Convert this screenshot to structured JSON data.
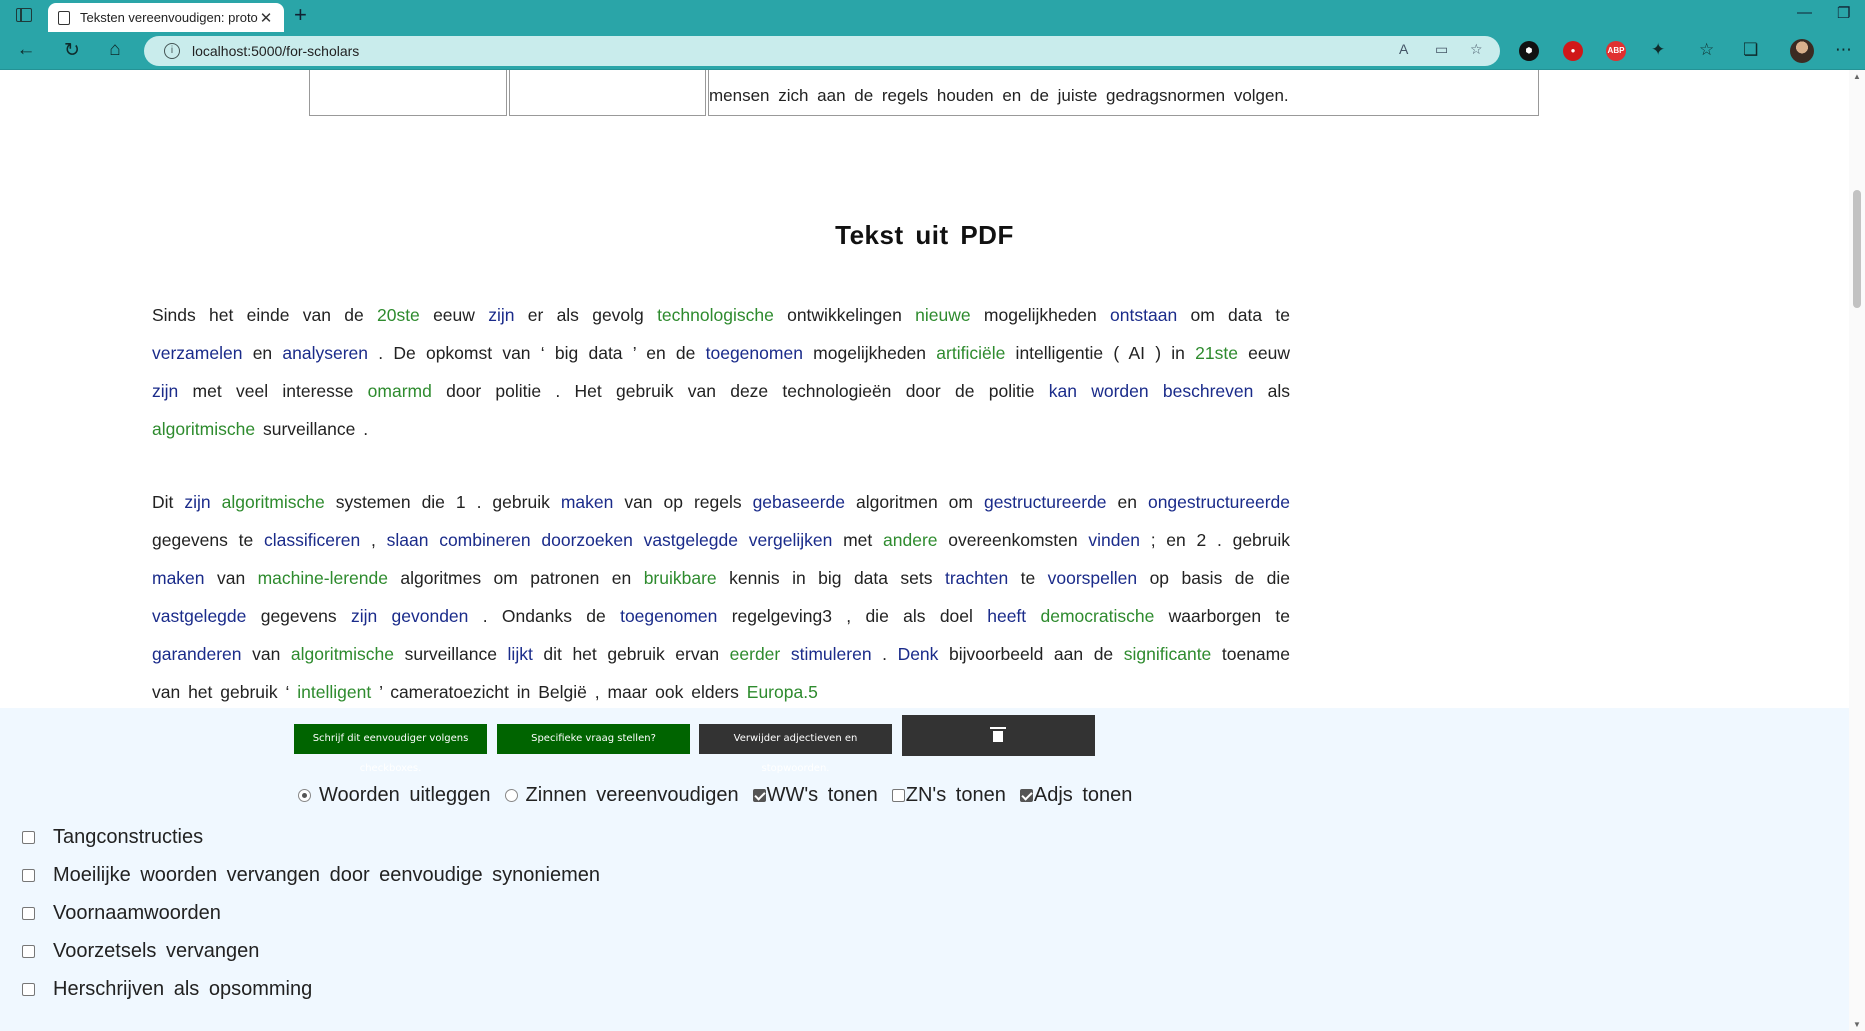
{
  "browser": {
    "tab_title": "Teksten vereenvoudigen: prototy",
    "url": "localhost:5000/for-scholars"
  },
  "table_remnant": {
    "text": "mensen zich aan de regels houden en de juiste gedragsnormen volgen."
  },
  "section": {
    "title": "Tekst uit PDF"
  },
  "paragraph1": [
    [
      [
        "n",
        "Sinds het einde van de "
      ],
      [
        "a",
        "20ste"
      ],
      [
        "n",
        " eeuw "
      ],
      [
        "v",
        "zijn"
      ],
      [
        "n",
        " er als gevolg "
      ],
      [
        "a",
        "technologische"
      ],
      [
        "n",
        " ontwikkelingen "
      ],
      [
        "a",
        "nieuwe"
      ],
      [
        "n",
        " mogelijkheden "
      ],
      [
        "v",
        "ontstaan"
      ],
      [
        "n",
        " om data te"
      ]
    ],
    [
      [
        "v",
        "verzamelen"
      ],
      [
        "n",
        " en "
      ],
      [
        "v",
        "analyseren"
      ],
      [
        "n",
        " . De opkomst van ‘ big data ’ en de "
      ],
      [
        "v",
        "toegenomen"
      ],
      [
        "n",
        " mogelijkheden "
      ],
      [
        "a",
        "artificiële"
      ],
      [
        "n",
        " intelligentie ( AI ) in "
      ],
      [
        "a",
        "21ste"
      ],
      [
        "n",
        " eeuw"
      ]
    ],
    [
      [
        "v",
        "zijn"
      ],
      [
        "n",
        " met veel interesse "
      ],
      [
        "a",
        "omarmd"
      ],
      [
        "n",
        " door politie . Het gebruik van deze technologieën door de politie "
      ],
      [
        "v",
        "kan worden beschreven"
      ],
      [
        "n",
        " als"
      ]
    ],
    [
      [
        "a",
        "algoritmische"
      ],
      [
        "n",
        " surveillance ."
      ]
    ]
  ],
  "paragraph2": [
    [
      [
        "n",
        "Dit "
      ],
      [
        "v",
        "zijn"
      ],
      [
        "n",
        " "
      ],
      [
        "a",
        "algoritmische"
      ],
      [
        "n",
        " systemen die 1 . gebruik "
      ],
      [
        "v",
        "maken"
      ],
      [
        "n",
        " van op regels "
      ],
      [
        "v",
        "gebaseerde"
      ],
      [
        "n",
        " algoritmen om "
      ],
      [
        "v",
        "gestructureerde"
      ],
      [
        "n",
        " en "
      ],
      [
        "v",
        "ongestructureerde"
      ]
    ],
    [
      [
        "n",
        "gegevens te "
      ],
      [
        "v",
        "classificeren"
      ],
      [
        "n",
        " , "
      ],
      [
        "v",
        "slaan combineren doorzoeken vastgelegde vergelijken"
      ],
      [
        "n",
        " met "
      ],
      [
        "a",
        "andere"
      ],
      [
        "n",
        " overeenkomsten "
      ],
      [
        "v",
        "vinden"
      ],
      [
        "n",
        " ; en 2 . gebruik"
      ]
    ],
    [
      [
        "v",
        "maken"
      ],
      [
        "n",
        " van "
      ],
      [
        "a",
        "machine-lerende"
      ],
      [
        "n",
        " algoritmes om patronen en "
      ],
      [
        "a",
        "bruikbare"
      ],
      [
        "n",
        " kennis in big data sets "
      ],
      [
        "v",
        "trachten"
      ],
      [
        "n",
        " te "
      ],
      [
        "v",
        "voorspellen"
      ],
      [
        "n",
        " op basis de die"
      ]
    ],
    [
      [
        "v",
        "vastgelegde"
      ],
      [
        "n",
        " gegevens "
      ],
      [
        "v",
        "zijn gevonden"
      ],
      [
        "n",
        " . Ondanks de "
      ],
      [
        "v",
        "toegenomen"
      ],
      [
        "n",
        " regelgeving3 , die als doel "
      ],
      [
        "v",
        "heeft"
      ],
      [
        "n",
        " "
      ],
      [
        "a",
        "democratische"
      ],
      [
        "n",
        " waarborgen te"
      ]
    ],
    [
      [
        "v",
        "garanderen"
      ],
      [
        "n",
        " van "
      ],
      [
        "a",
        "algoritmische"
      ],
      [
        "n",
        " surveillance "
      ],
      [
        "v",
        "lijkt"
      ],
      [
        "n",
        " dit het gebruik ervan "
      ],
      [
        "a",
        "eerder"
      ],
      [
        "n",
        " "
      ],
      [
        "v",
        "stimuleren"
      ],
      [
        "n",
        " . "
      ],
      [
        "v",
        "Denk"
      ],
      [
        "n",
        " bijvoorbeeld aan de "
      ],
      [
        "a",
        "significante"
      ],
      [
        "n",
        " toename"
      ]
    ],
    [
      [
        "n",
        "van het gebruik ‘ "
      ],
      [
        "a",
        "intelligent"
      ],
      [
        "n",
        " ’ cameratoezicht in België , maar ook elders "
      ],
      [
        "a",
        "Europa.5"
      ]
    ]
  ],
  "controls": {
    "btn_simplify": "Schrijf dit eenvoudiger volgens checkboxes.",
    "btn_question": "Specifieke vraag stellen?",
    "btn_remove": "Verwijder adjectieven en stopwoorden.",
    "radio_explain": "Woorden uitleggen",
    "radio_simplify": "Zinnen vereenvoudigen",
    "cb_ww": "WW's tonen",
    "cb_zn": "ZN's tonen",
    "cb_adj": "Adjs tonen"
  },
  "checklist": [
    "Tangconstructies",
    "Moeilijke woorden vervangen door eenvoudige synoniemen",
    "Voornaamwoorden",
    "Voorzetsels vervangen",
    "Herschrijven als opsomming"
  ],
  "colors": {
    "verb": "#1a2b8a",
    "adjective": "#2e8b2e",
    "button_green": "#006400",
    "button_dark": "#333333",
    "chrome": "#2aa5a8"
  }
}
